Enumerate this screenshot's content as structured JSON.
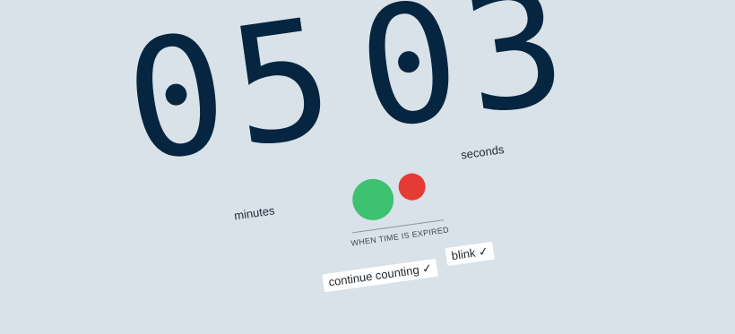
{
  "timer": {
    "digits": [
      "0",
      "5",
      "0",
      "3"
    ],
    "minutes_label": "minutes",
    "seconds_label": "seconds"
  },
  "status": {
    "running_color": "#3cc271",
    "stopped_color": "#e43c33"
  },
  "expired": {
    "heading": "WHEN TIME IS EXPIRED",
    "options": [
      {
        "label": "continue counting ✓"
      },
      {
        "label": "blink ✓"
      }
    ]
  }
}
